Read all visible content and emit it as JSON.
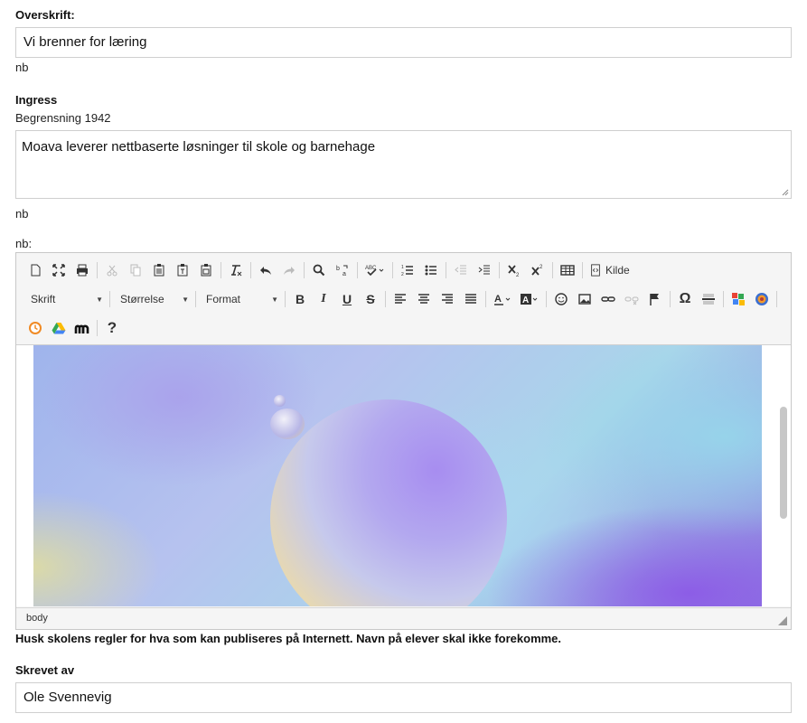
{
  "headline": {
    "label": "Overskrift:",
    "value": "Vi brenner for læring",
    "lang": "nb"
  },
  "lead": {
    "label": "Ingress",
    "limit": "Begrensning 1942",
    "value": "Moava leverer nettbaserte løsninger til skole og barnehage",
    "lang": "nb"
  },
  "body_editor": {
    "lang_label": "nb:",
    "source_label": "Kilde",
    "font_combo": "Skrift",
    "size_combo": "Størrelse",
    "format_combo": "Format",
    "status_path": "body",
    "help_glyph": "?",
    "omega_glyph": "Ω"
  },
  "notice": "Husk skolens regler for hva som kan publiseres på Internett. Navn på elever skal ikke forekomme.",
  "author": {
    "label": "Skrevet av",
    "value": "Ole Svennevig"
  },
  "colors": {
    "border": "#cfcfcf",
    "toolbar_bg": "#f5f5f5"
  }
}
